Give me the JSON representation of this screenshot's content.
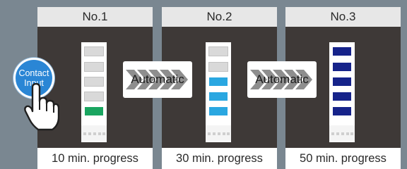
{
  "panels": [
    {
      "title": "No.1",
      "caption": "10 min. progress",
      "lit_segments": 1,
      "lit_color": "#1aa560"
    },
    {
      "title": "No.2",
      "caption": "30 min. progress",
      "lit_segments": 3,
      "lit_color": "#2aa7e1"
    },
    {
      "title": "No.3",
      "caption": "50 min. progress",
      "lit_segments": 5,
      "lit_color": "#16238a"
    }
  ],
  "connectors": [
    {
      "label": "Automatic"
    },
    {
      "label": "Automatic"
    }
  ],
  "contact_button": {
    "line1": "Contact",
    "line2": "Input",
    "color": "#2a86d5"
  },
  "tower_total_segments": 5,
  "colors": {
    "background": "#7a8791",
    "panel": "#3e3937",
    "arrow": "#8e8e8e"
  }
}
